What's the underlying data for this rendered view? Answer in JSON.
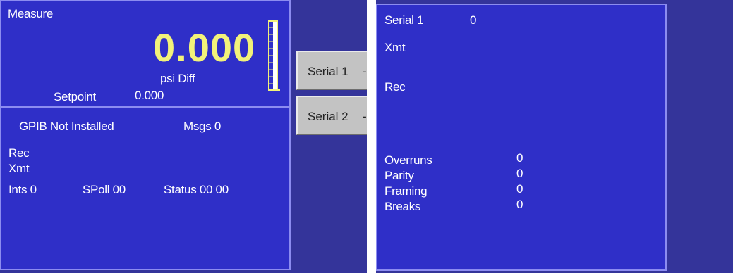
{
  "colors": {
    "panel_blue": "#2f2fc8",
    "panel_dark": "#34349a",
    "border": "#8c8cf0",
    "reading_yellow": "#f2f27a",
    "button_gray": "#c3c3c3"
  },
  "measure": {
    "title": "Measure",
    "value": "0.000",
    "unit": "psi Diff",
    "setpoint_label": "Setpoint",
    "setpoint_value": "0.000",
    "bar_graph_level": 0.0
  },
  "gpib": {
    "status": "GPIB Not Installed",
    "msgs": "Msgs 0",
    "rec_label": "Rec",
    "xmt_label": "Xmt",
    "ints": "Ints 0",
    "spoll": "SPoll 00",
    "status_text": "Status 00 00"
  },
  "tabs": [
    {
      "label": "Serial 1"
    },
    {
      "label": "Serial 2"
    }
  ],
  "serial": {
    "title": "Serial 1",
    "count": "0",
    "xmt_label": "Xmt",
    "rec_label": "Rec",
    "errors": [
      {
        "label": "Overruns",
        "value": "0"
      },
      {
        "label": "Parity",
        "value": "0"
      },
      {
        "label": "Framing",
        "value": "0"
      },
      {
        "label": "Breaks",
        "value": "0"
      }
    ]
  }
}
